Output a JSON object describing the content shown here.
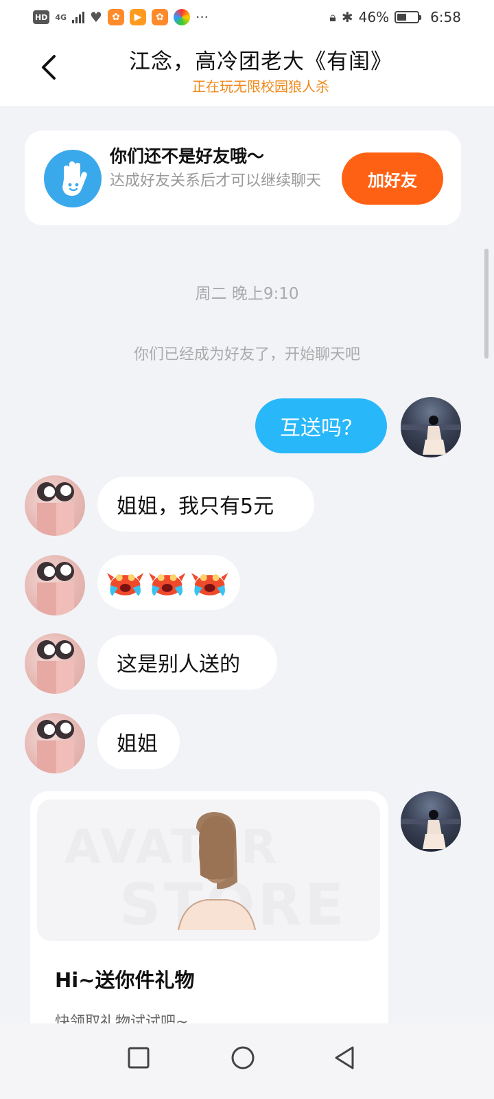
{
  "status_bar": {
    "left_badges": [
      "HD",
      "4G"
    ],
    "battery": "46%",
    "battery_level": 0.46,
    "time": "6:58"
  },
  "header": {
    "title": "江念，高冷团老大《有闺》",
    "subtitle": "正在玩无限校园狼人杀"
  },
  "friend_banner": {
    "title": "你们还不是好友哦～",
    "description": "达成好友关系后才可以继续聊天",
    "button": "加好友"
  },
  "chat": {
    "timestamp": "周二 晚上9:10",
    "system_message": "你们已经成为好友了，开始聊天吧",
    "messages": [
      {
        "from": "me",
        "text": "互送吗？"
      },
      {
        "from": "other",
        "text": "姐姐，我只有5元"
      },
      {
        "from": "other",
        "text": "",
        "emoji": "crying-crab",
        "count": 3
      },
      {
        "from": "other",
        "text": "这是别人送的"
      },
      {
        "from": "other",
        "text": "姐姐"
      }
    ],
    "gift_card": {
      "watermark_line1": "AVATAR",
      "watermark_line2": "STORE",
      "title": "Hi~送你件礼物",
      "subtitle": "快领取礼物试试吧~"
    }
  },
  "colors": {
    "accent_blue": "#28b8fa",
    "add_friend_orange": "#ff6114",
    "subtitle_orange": "#f08a1c",
    "background": "#f2f3f7"
  },
  "nav": {
    "icons": [
      "square-recents-icon",
      "circle-home-icon",
      "triangle-back-icon"
    ]
  }
}
